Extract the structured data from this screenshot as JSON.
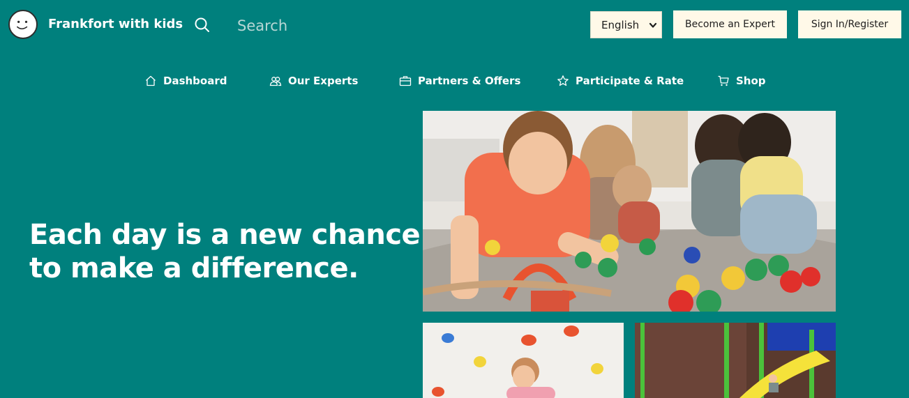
{
  "header": {
    "brand": "Frankfort with kids",
    "search_placeholder": "Search",
    "language": {
      "selected": "English"
    },
    "become_expert_label": "Become an Expert",
    "sign_in_label": "Sign In/Register"
  },
  "nav": {
    "items": [
      {
        "label": "Dashboard",
        "icon": "home-icon"
      },
      {
        "label": "Our Experts",
        "icon": "users-icon"
      },
      {
        "label": "Partners & Offers",
        "icon": "briefcase-icon"
      },
      {
        "label": "Participate & Rate",
        "icon": "star-icon"
      },
      {
        "label": "Shop",
        "icon": "cart-icon"
      }
    ]
  },
  "hero": {
    "heading_line1": "Each day is a new chance",
    "heading_line2": "to make a difference."
  },
  "colors": {
    "background": "#00807d",
    "button_bg": "#fff9e8",
    "button_text": "#1e1e1e"
  }
}
